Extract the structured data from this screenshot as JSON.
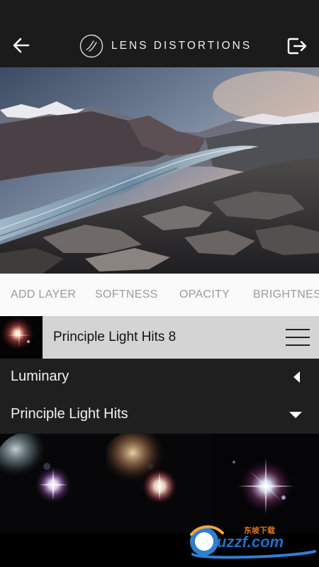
{
  "header": {
    "title": "LENS DISTORTIONS",
    "back_icon": "back-arrow-icon",
    "export_icon": "export-icon",
    "logo_icon": "lens-distortions-logo"
  },
  "tabs": [
    "ADD LAYER",
    "SOFTNESS",
    "OPACITY",
    "BRIGHTNESS"
  ],
  "selected_layer": {
    "name": "Principle Light Hits 8",
    "menu_icon": "hamburger-menu-icon"
  },
  "categories": [
    {
      "label": "Luminary",
      "state": "collapsed",
      "icon": "triangle-left-icon"
    },
    {
      "label": "Principle Light Hits",
      "state": "expanded",
      "icon": "triangle-down-icon"
    }
  ],
  "watermark": {
    "domain": "uzzf.com",
    "site_name": "东坡下载"
  },
  "colors": {
    "topbar": "#1b1b1b",
    "tabs_background": "#fafafa",
    "tab_text": "#9b9b9b",
    "selected_layer_background": "#d4d4d4",
    "category_background": "#1f1f1f"
  }
}
